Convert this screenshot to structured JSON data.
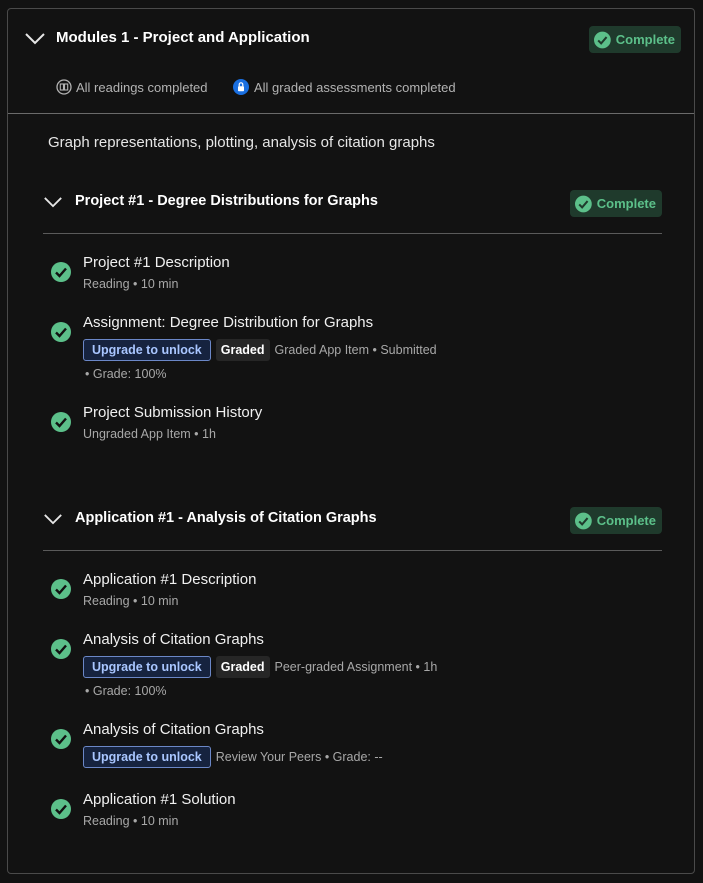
{
  "module": {
    "title": "Modules 1 - Project and Application",
    "complete_label": "Complete",
    "readings_status": "All readings completed",
    "assessments_status": "All graded assessments completed",
    "description": "Graph representations, plotting, analysis of citation graphs"
  },
  "colors": {
    "background": "#121212",
    "complete_green": "#5cc08a",
    "complete_bg": "#1f3a2c",
    "upgrade_border": "#6b87c7",
    "upgrade_text": "#a9c6ff",
    "lock_blue": "#1a6fe0"
  },
  "sections": [
    {
      "title": "Project #1 - Degree Distributions for Graphs",
      "complete_label": "Complete",
      "items": [
        {
          "title": "Project #1 Description",
          "meta": "Reading • 10 min",
          "icon": "check-circle-icon"
        },
        {
          "title": "Assignment: Degree Distribution for Graphs",
          "upgrade": "Upgrade to unlock",
          "graded": "Graded",
          "meta": "Graded App Item • Submitted",
          "grade": "• Grade: 100%",
          "icon": "check-circle-icon"
        },
        {
          "title": "Project Submission History",
          "meta": "Ungraded App Item • 1h",
          "icon": "check-circle-icon"
        }
      ]
    },
    {
      "title": "Application #1 - Analysis of Citation Graphs",
      "complete_label": "Complete",
      "items": [
        {
          "title": "Application #1 Description",
          "meta": "Reading • 10 min",
          "icon": "check-circle-icon"
        },
        {
          "title": "Analysis of Citation Graphs",
          "upgrade": "Upgrade to unlock",
          "graded": "Graded",
          "meta": "Peer-graded Assignment • 1h",
          "grade": "• Grade: 100%",
          "icon": "check-circle-icon"
        },
        {
          "title": "Analysis of Citation Graphs",
          "upgrade": "Upgrade to unlock",
          "meta": "Review Your Peers • Grade: --",
          "icon": "check-circle-icon"
        },
        {
          "title": "Application #1 Solution",
          "meta": "Reading • 10 min",
          "icon": "check-circle-icon"
        }
      ]
    }
  ]
}
